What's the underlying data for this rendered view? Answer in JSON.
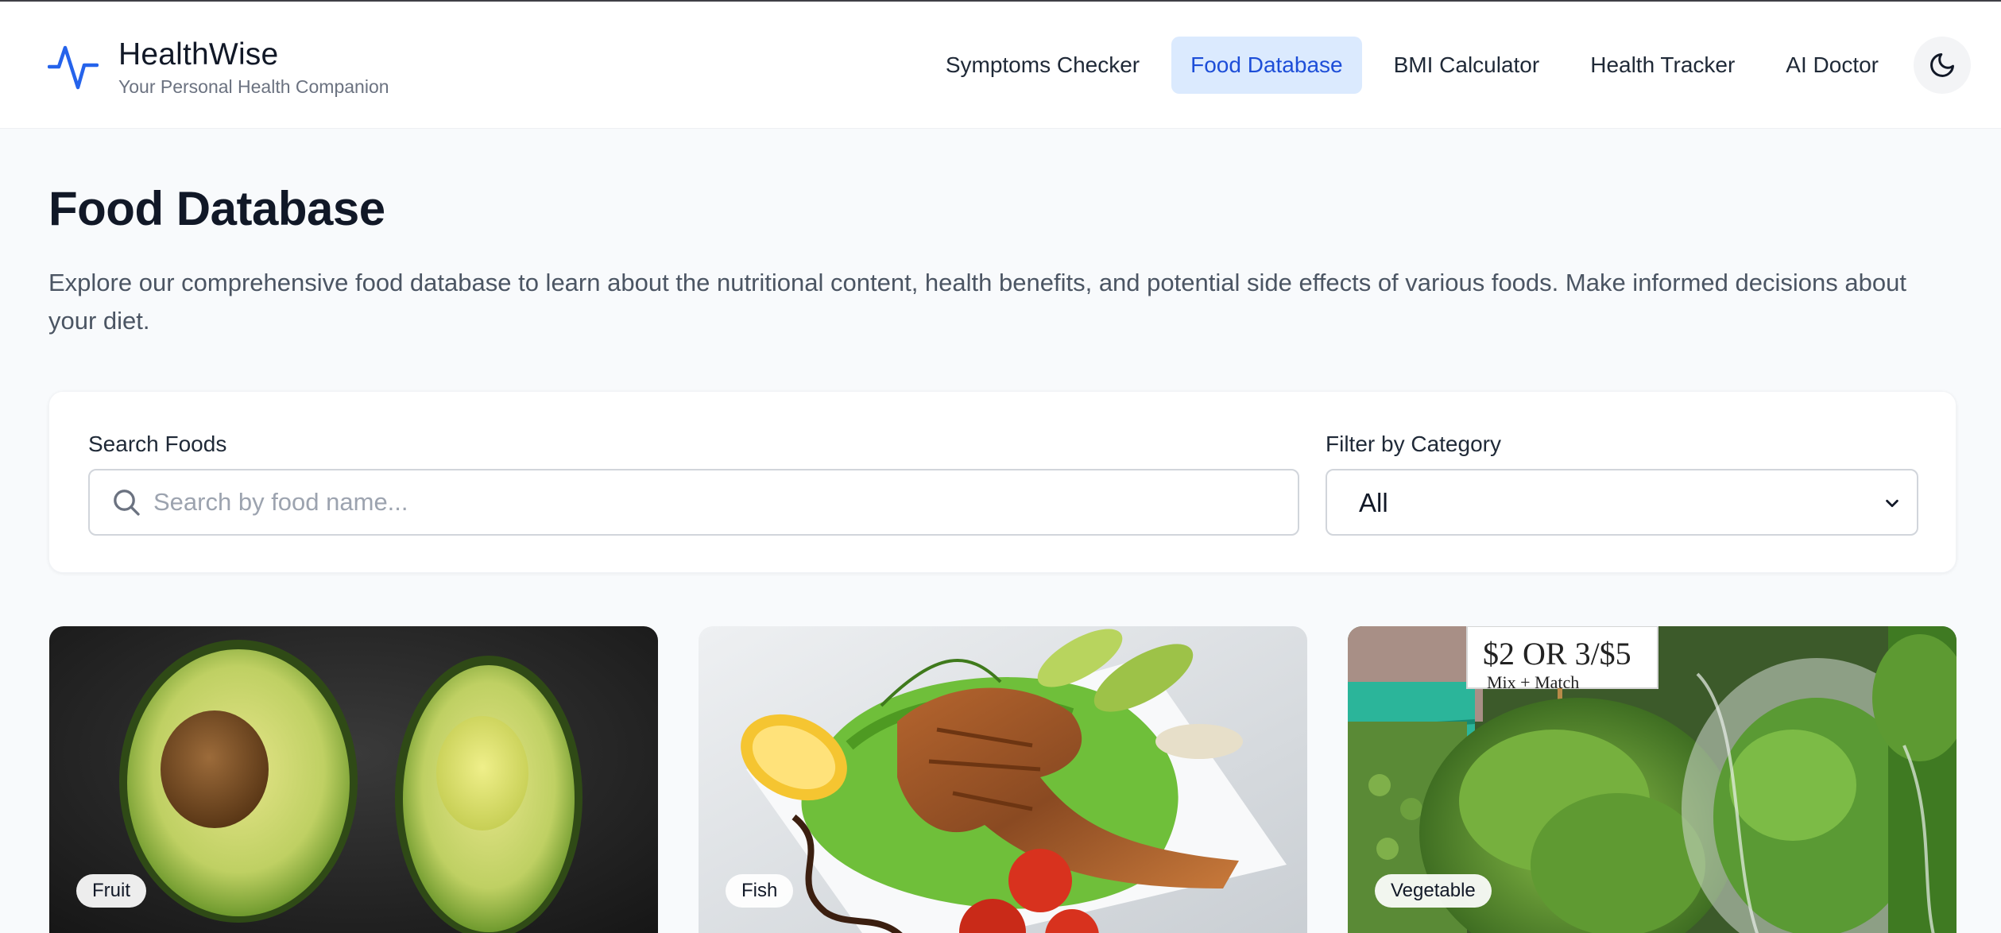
{
  "brand": {
    "title": "HealthWise",
    "subtitle": "Your Personal Health Companion",
    "accent_color": "#2563eb"
  },
  "nav": {
    "items": [
      {
        "label": "Symptoms Checker",
        "active": false
      },
      {
        "label": "Food Database",
        "active": true
      },
      {
        "label": "BMI Calculator",
        "active": false
      },
      {
        "label": "Health Tracker",
        "active": false
      },
      {
        "label": "AI Doctor",
        "active": false
      }
    ],
    "theme_toggle_icon": "moon-icon"
  },
  "page": {
    "title": "Food Database",
    "description": "Explore our comprehensive food database to learn about the nutritional content, health benefits, and potential side effects of various foods. Make informed decisions about your diet."
  },
  "filters": {
    "search_label": "Search Foods",
    "search_placeholder": "Search by food name...",
    "search_value": "",
    "category_label": "Filter by Category",
    "category_value": "All"
  },
  "foods": [
    {
      "category": "Fruit",
      "image": "avocado halves on dark slate"
    },
    {
      "category": "Fish",
      "image": "grilled salmon on salad with lemon and tomatoes"
    },
    {
      "category": "Vegetable",
      "image": "leafy greens at market with price sign"
    }
  ],
  "market_sign": {
    "line1": "$2 OR 3/$5",
    "line2": "Mix + Match"
  }
}
